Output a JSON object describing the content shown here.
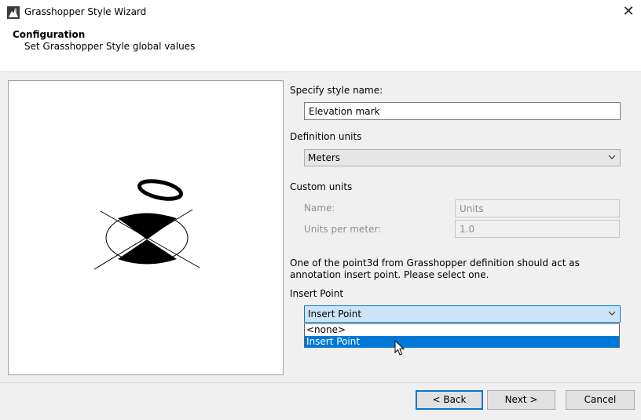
{
  "window": {
    "title": "Grasshopper Style Wizard"
  },
  "header": {
    "title": "Configuration",
    "subtitle": "Set Grasshopper Style global values"
  },
  "form": {
    "style_name_label": "Specify style name:",
    "style_name_value": "Elevation  mark",
    "definition_units_label": "Definition units",
    "definition_units_value": "Meters",
    "custom_units_label": "Custom units",
    "name_label": "Name:",
    "name_value": "Units",
    "units_per_meter_label": "Units per meter:",
    "units_per_meter_value": "1.0",
    "note": "One of the point3d from Grasshopper definition should act as annotation insert point. Please select one.",
    "insert_point_label": "Insert Point",
    "insert_point_value": "Insert Point",
    "insert_point_options": [
      "<none>",
      "Insert Point"
    ]
  },
  "buttons": {
    "back": "< Back",
    "next": "Next >",
    "cancel": "Cancel"
  },
  "icons": {
    "app": "rhino-icon",
    "close": "close-icon",
    "chevron": "chevron-down-icon",
    "cursor": "mouse-pointer-icon"
  },
  "colors": {
    "accent": "#0078d7",
    "selection": "#0078d7",
    "focus_fill": "#cce4f7"
  }
}
